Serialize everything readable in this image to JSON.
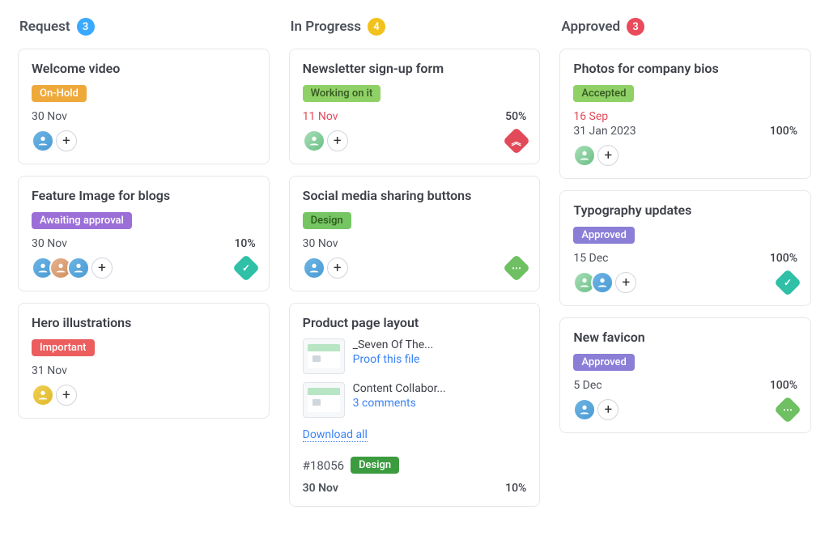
{
  "columns": [
    {
      "title": "Request",
      "count": "3",
      "countColor": "blue",
      "cards": [
        {
          "title": "Welcome video",
          "badge": "On-Hold",
          "badgeClass": "onhold",
          "date": "30 Nov",
          "dateRed": false,
          "avatars": [
            "c1"
          ],
          "percent": ""
        },
        {
          "title": "Feature Image for blogs",
          "badge": "Awaiting approval",
          "badgeClass": "awaiting",
          "date": "30 Nov",
          "dateRed": false,
          "percent": "10%",
          "avatars": [
            "c1",
            "c2",
            "c1"
          ],
          "priority": "teal",
          "prioritySymbol": "✓"
        },
        {
          "title": "Hero illustrations",
          "badge": "Important",
          "badgeClass": "important",
          "date": "31 Nov",
          "dateRed": false,
          "avatars": [
            "c4"
          ],
          "percent": ""
        }
      ]
    },
    {
      "title": "In Progress",
      "count": "4",
      "countColor": "yellow",
      "cards": [
        {
          "title": "Newsletter sign-up form",
          "badge": "Working on it",
          "badgeClass": "working",
          "date": "11 Nov",
          "dateRed": true,
          "percent": "50%",
          "avatars": [
            "c3"
          ],
          "priority": "red",
          "prioritySymbol": "︽"
        },
        {
          "title": "Social media sharing buttons",
          "badge": "Design",
          "badgeClass": "design",
          "date": "30 Nov",
          "dateRed": false,
          "percent": "",
          "avatars": [
            "c1"
          ],
          "priority": "green",
          "prioritySymbol": "⋯"
        },
        {
          "title": "Product page layout",
          "files": [
            {
              "name": "_Seven Of The...",
              "link": "Proof this file"
            },
            {
              "name": "Content Collabor...",
              "link": "3 comments"
            }
          ],
          "download": "Download all",
          "id": "#18056",
          "badge2": "Design",
          "badge2Class": "design-dark",
          "date": "30 Nov",
          "dateRed": false,
          "percent": "10%"
        }
      ]
    },
    {
      "title": "Approved",
      "count": "3",
      "countColor": "red",
      "cards": [
        {
          "title": "Photos for company bios",
          "badge": "Accepted",
          "badgeClass": "accepted",
          "date": "16 Sep",
          "dateRed": true,
          "date2": "31 Jan 2023",
          "percent": "100%",
          "avatars": [
            "c3"
          ]
        },
        {
          "title": "Typography updates",
          "badge": "Approved",
          "badgeClass": "approved",
          "date": "15 Dec",
          "dateRed": false,
          "percent": "100%",
          "avatars": [
            "c3",
            "c1"
          ],
          "priority": "teal",
          "prioritySymbol": "✓"
        },
        {
          "title": "New favicon",
          "badge": "Approved",
          "badgeClass": "approved",
          "date": "5 Dec",
          "dateRed": false,
          "percent": "100%",
          "avatars": [
            "c1"
          ],
          "priority": "green",
          "prioritySymbol": "⋯"
        }
      ]
    }
  ],
  "addLabel": "+"
}
